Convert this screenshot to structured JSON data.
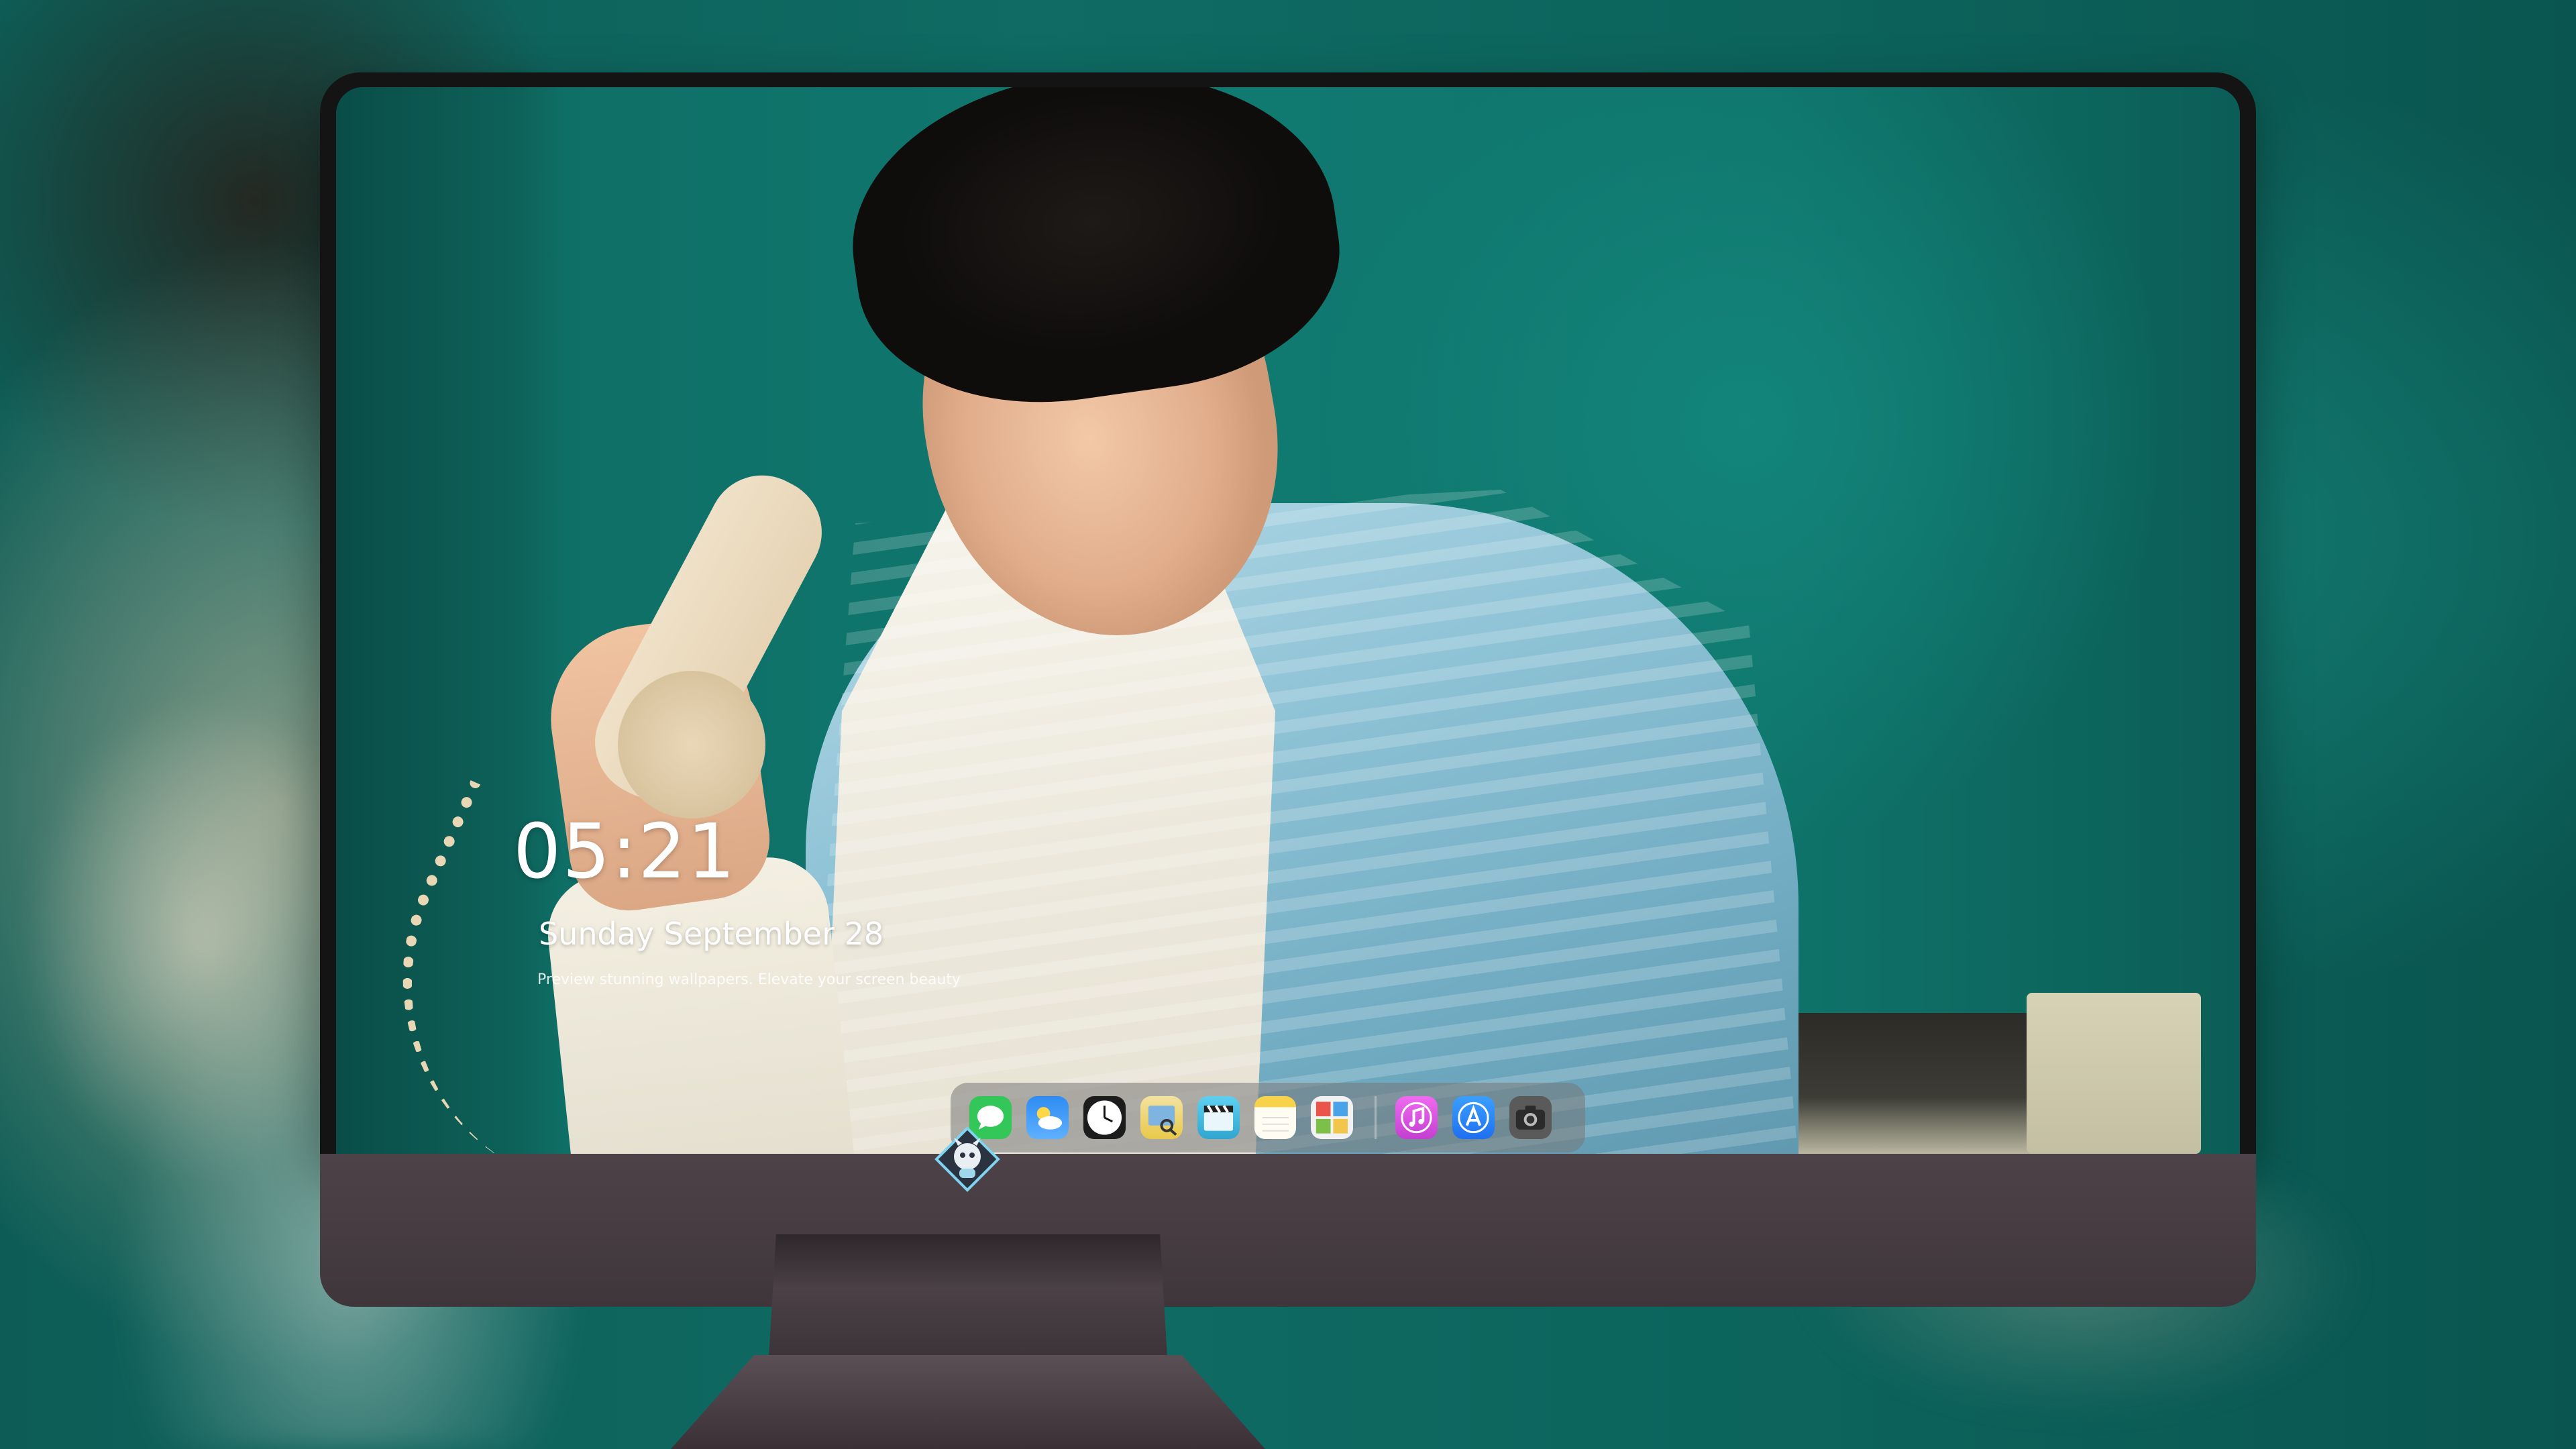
{
  "lock_screen": {
    "time": "05:21",
    "date": "Sunday September 28",
    "caption": "Preview stunning wallpapers. Elevate your screen beauty"
  },
  "dock": {
    "apps": [
      {
        "name": "Messages",
        "icon": "messages-icon",
        "color": "#33c759"
      },
      {
        "name": "Weather",
        "icon": "weather-icon",
        "color": "#2f8cf2"
      },
      {
        "name": "Clock",
        "icon": "clock-icon",
        "color": "#1c1c1c"
      },
      {
        "name": "Preview",
        "icon": "preview-icon",
        "color": "#e9c84a"
      },
      {
        "name": "Clapper",
        "icon": "clapperboard-icon",
        "color": "#4dc6e6"
      },
      {
        "name": "Notes",
        "icon": "notes-icon",
        "color": "#f6d34a"
      },
      {
        "name": "Photo Booth",
        "icon": "photo-booth-icon",
        "color": "#b9d36b"
      },
      {
        "name": "Music",
        "icon": "music-icon",
        "color": "#e04fe0"
      },
      {
        "name": "App Store",
        "icon": "app-store-icon",
        "color": "#1f8ef1"
      },
      {
        "name": "Camera",
        "icon": "camera-icon",
        "color": "#5a5a5a"
      }
    ]
  },
  "monitor": {
    "brand_logo": "mascot-logo-icon",
    "chin_color": "#4a4045"
  }
}
